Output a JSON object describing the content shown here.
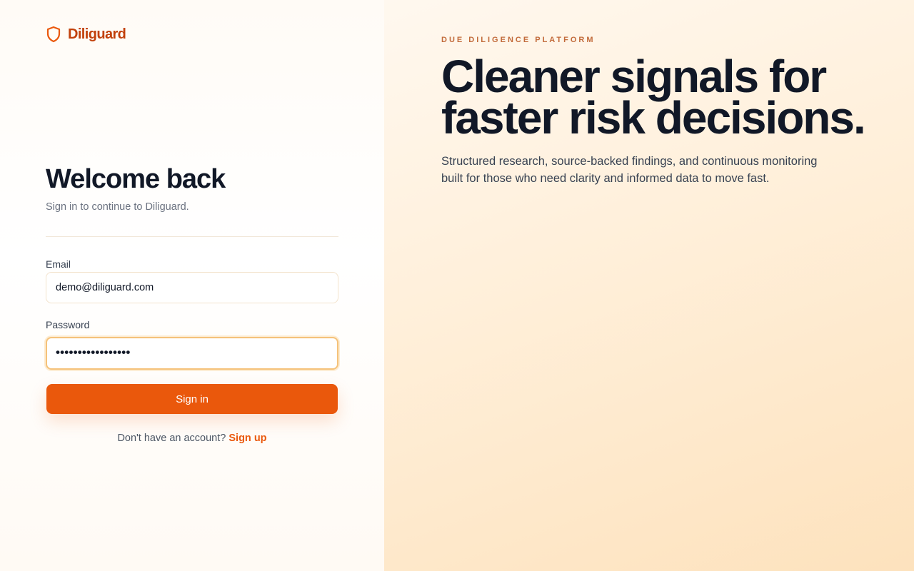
{
  "brand": {
    "name": "Diliguard",
    "icon": "shield-icon",
    "color": "#c2410c"
  },
  "login": {
    "title": "Welcome back",
    "subtitle": "Sign in to continue to Diliguard.",
    "email_label": "Email",
    "email_value": "demo@diliguard.com",
    "password_label": "Password",
    "password_masked": "•••••••••••••••••",
    "submit_label": "Sign in",
    "signup_prompt": "Don't have an account?",
    "signup_link": "Sign up"
  },
  "hero": {
    "eyebrow": "DUE DILIGENCE PLATFORM",
    "headline_lines": [
      "Cleaner signals for",
      "faster risk decisions."
    ],
    "description_lines": [
      "Structured research, source-backed findings, and continuous monitoring",
      "built for those who need clarity and informed data to move fast."
    ]
  },
  "colors": {
    "accent": "#ea580c",
    "heading": "#111827",
    "eyebrow": "#c26a3a"
  }
}
